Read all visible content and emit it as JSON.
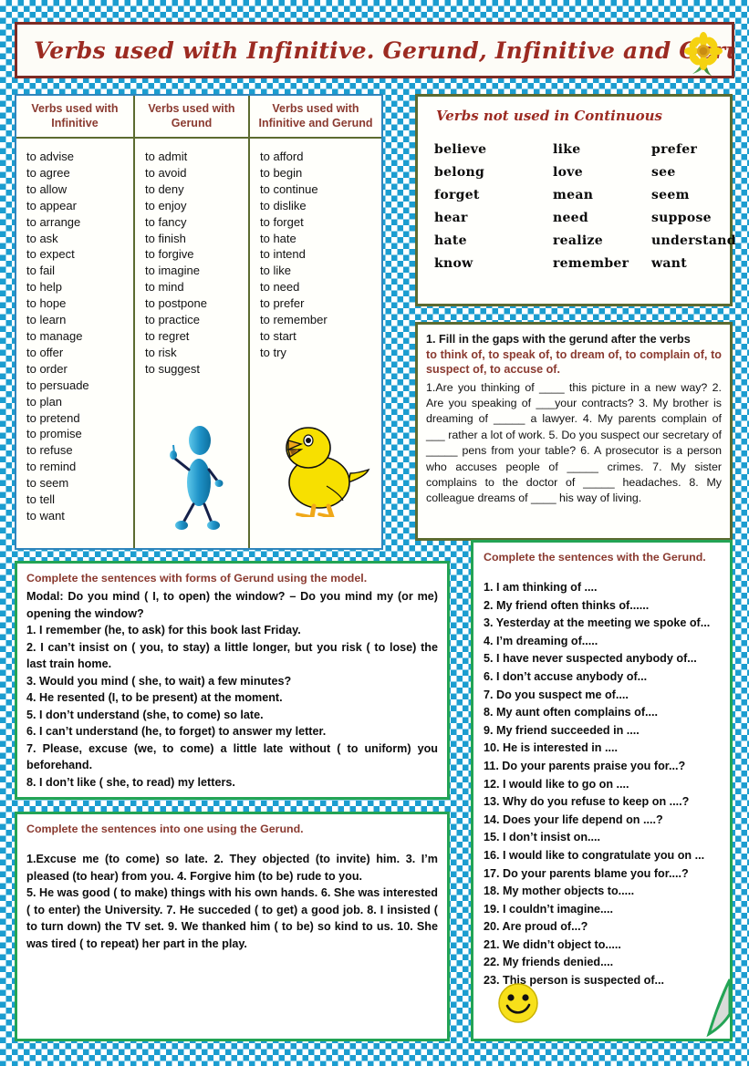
{
  "title": {
    "text": "Verbs used with Infinitive. Gerund, Infinitive and Gerund",
    "border_color": "#7d2b24",
    "text_color": "#9c2b22",
    "decoration_icon": "sunflower-icon"
  },
  "verb_table": {
    "columns": [
      {
        "header": "Verbs used with Infinitive",
        "verbs": [
          "to advise",
          "to agree",
          "to allow",
          "to appear",
          "to arrange",
          "to ask",
          "to expect",
          "to fail",
          "to help",
          "to hope",
          "to learn",
          "to manage",
          "to offer",
          "to order",
          "to persuade",
          "to plan",
          "to pretend",
          "to promise",
          "to refuse",
          "to remind",
          "to seem",
          "to tell",
          "to want"
        ]
      },
      {
        "header": "Verbs used with Gerund",
        "verbs": [
          "to admit",
          "to avoid",
          "to deny",
          "to enjoy",
          "to fancy",
          "to finish",
          "to forgive",
          "to imagine",
          "to mind",
          "to postpone",
          "to practice",
          "to regret",
          "to  risk",
          "to suggest"
        ],
        "illustration": "stick-figure-icon"
      },
      {
        "header": "Verbs used with Infinitive and Gerund",
        "verbs": [
          "to afford",
          "to begin",
          "to continue",
          "to dislike",
          "to forget",
          "to hate",
          "to intend",
          "to like",
          "to need",
          "to prefer",
          "to remember",
          "to start",
          "to try"
        ],
        "illustration": "chick-icon"
      }
    ],
    "header_color": "#8a3a30",
    "grid_color": "#5c6b30",
    "outer_border_color": "#2f86bd"
  },
  "not_continuous": {
    "title": "Verbs not used in Continuous",
    "border_color": "#5c6b30",
    "title_color": "#9c2b22",
    "columns": [
      [
        "believe",
        "belong",
        "forget",
        "hear",
        "hate",
        "know"
      ],
      [
        "like",
        "love",
        "mean",
        "need",
        "realize",
        "remember"
      ],
      [
        "prefer",
        "see",
        "seem",
        "suppose",
        "understand",
        "want"
      ]
    ]
  },
  "exercise_1": {
    "heading_black": "1. Fill in the gaps with the gerund after the verbs",
    "heading_red": "to think of, to speak of, to dream of, to complain of, to suspect of, to accuse of.",
    "body": "1.Are you thinking of ____ this picture in a new way?   2. Are you speaking of ___your contracts? 3. My brother is dreaming of _____ a lawyer.   4. My parents complain of ___ rather a lot of work.   5. Do you suspect our secretary of _____ pens from your table?   6. A prosecutor is a person who accuses people of _____ crimes.   7. My sister complains to the doctor of _____ headaches.   8. My colleague dreams of ____ his way of living.",
    "border_color": "#5c6b30"
  },
  "exercise_model": {
    "heading": "Complete the sentences with forms of Gerund using the model.",
    "model": "Modal: Do you mind ( I, to open) the window? – Do you mind my (or me) opening the window?",
    "items": [
      "1. I remember (he, to ask) for this book last Friday.",
      "2. I can’t insist on ( you, to stay) a little longer, but you risk ( to lose) the last train home.",
      "3. Would you mind ( she, to wait) a few minutes?",
      "4. He resented  (I, to be present) at the moment.",
      "5. I don’t understand (she, to come) so late.",
      "6. I can’t understand (he, to forget) to answer my letter.",
      "7. Please, excuse (we, to come) a little late without ( to uniform) you beforehand.",
      "8. I don’t like ( she, to read) my letters."
    ],
    "border_color": "#23a455"
  },
  "exercise_combine": {
    "heading": "Complete the sentences into one using the Gerund.",
    "body": "1.Excuse me (to come) so late.  2. They objected (to invite) him.  3. I’m pleased (to hear) from you.   4. Forgive him (to be) rude to you.",
    "body2": "5. He was good ( to make) things with his own hands.  6. She was interested ( to enter) the University. 7. He succeded ( to get) a good job. 8. I insisted ( to turn down) the TV set.  9. We thanked him ( to be) so kind to us. 10. She was tired ( to repeat) her part in the play.",
    "border_color": "#23a455"
  },
  "exercise_gerund_list": {
    "heading": "Complete the sentences with the Gerund.",
    "items": [
      "1. I am thinking of ....",
      "2. My friend often thinks of......",
      "3. Yesterday at the meeting we spoke of...",
      "4. I’m dreaming of.....",
      "5. I have never suspected anybody of...",
      "6. I don’t accuse anybody of...",
      "7. Do you suspect me of....",
      "8. My aunt often complains of....",
      "9. My friend succeeded in ....",
      "10. He is interested in ....",
      "11. Do your parents praise you for...?",
      "12. I would like to go on ....",
      "13. Why do you refuse to keep on ....?",
      "14. Does your life depend on ....?",
      "15. I don’t insist on....",
      "16. I would like to congratulate you on ...",
      "17. Do your parents blame you for....?",
      "18. My mother objects to.....",
      "19. I couldn’t imagine....",
      "20. Are proud of...?",
      "21. We didn’t object to.....",
      "22. My friends denied....",
      "23. This person is suspected of..."
    ],
    "smiley_icon": "smiley-face-icon",
    "corner_icon": "page-curl-icon",
    "border_color": "#23a455"
  }
}
